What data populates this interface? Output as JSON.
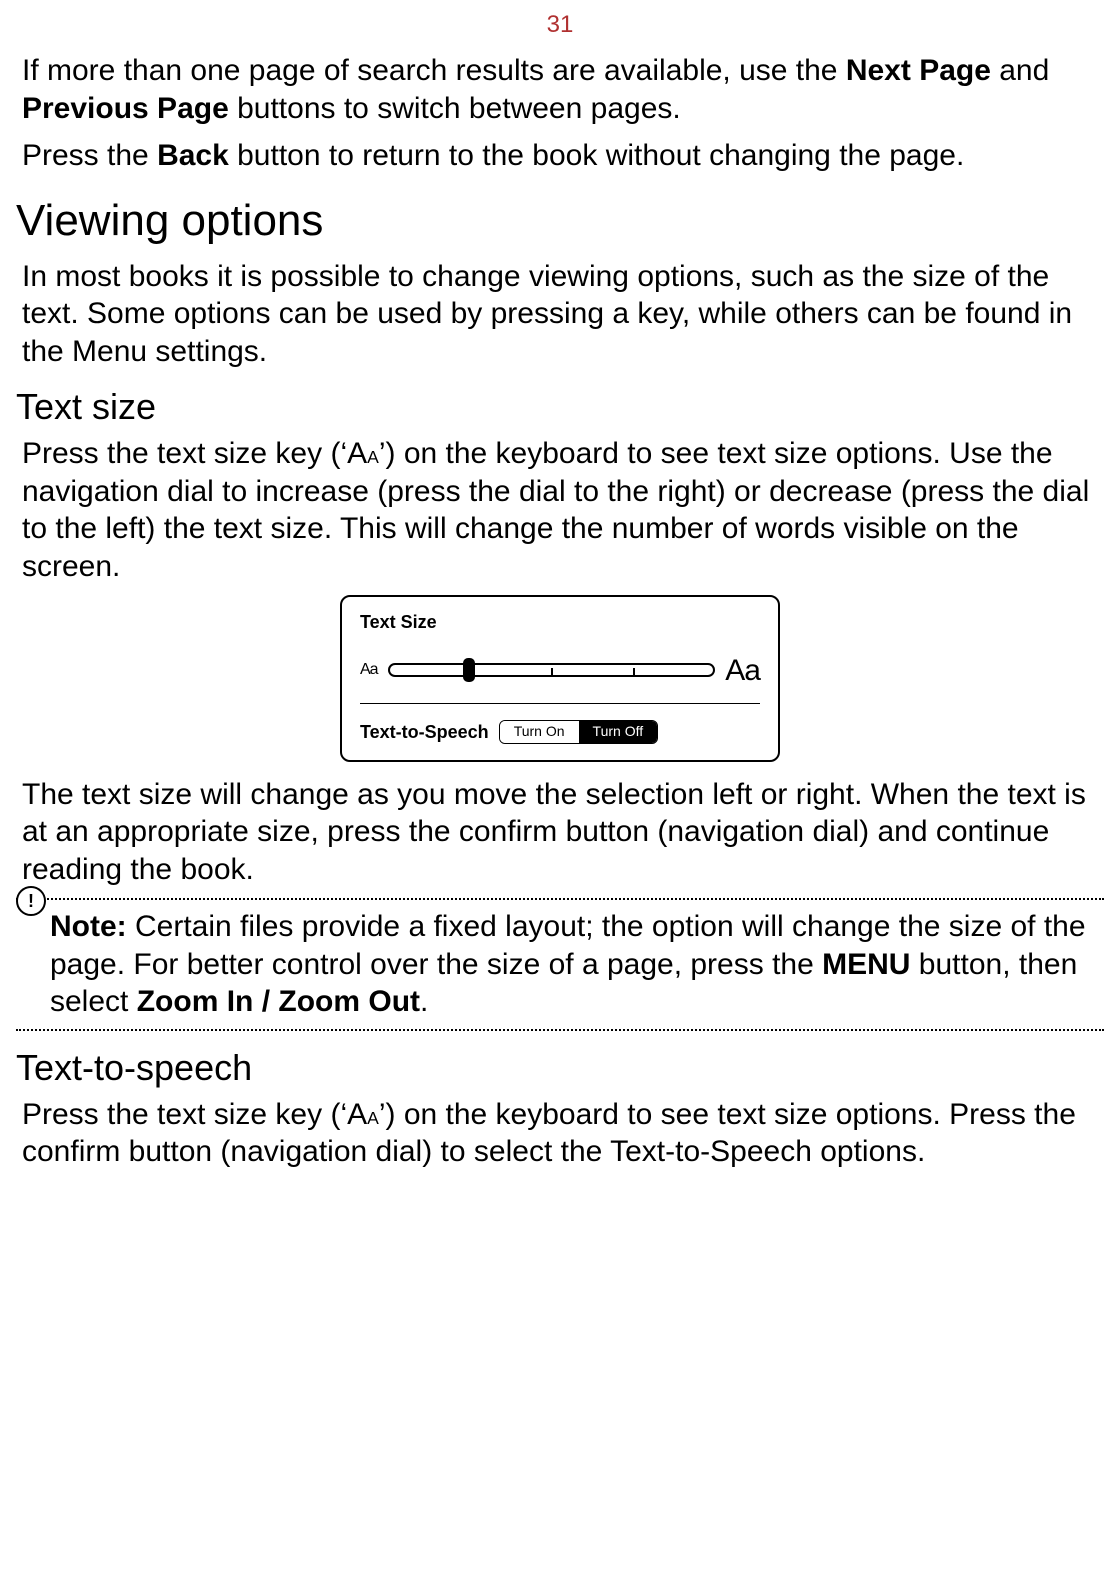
{
  "page": {
    "number": "31"
  },
  "intro": {
    "p1_a": "If more than one page of search results are available, use the ",
    "p1_b1": "Next Page",
    "p1_c": " and ",
    "p1_b2": "Previous Page",
    "p1_d": " buttons to switch between pages.",
    "p2_a": "Press the ",
    "p2_b": "Back",
    "p2_c": " button to return to the book without changing the page."
  },
  "sections": {
    "viewing_options": {
      "title": "Viewing options",
      "intro": "In most books it is possible to change viewing options, such as the size of the text. Some options can be used by pressing a key, while others can be found in the Menu settings."
    },
    "text_size": {
      "title": "Text size",
      "p1_a": "Press the text size key (‘A",
      "p1_small": "A",
      "p1_b": "’) on the keyboard to see text size options. Use the navigation dial to increase (press the dial to the right) or decrease (press the dial to the left) the text size. This will change the number of words visible on the screen.",
      "p2": "The text size will change as you move the selection left or right. When the text is at an appropriate size, press the confirm button (navigation dial) and continue reading the book."
    },
    "text_to_speech": {
      "title": "Text-to-speech",
      "p1_a": "Press the text size key (‘A",
      "p1_small": "A",
      "p1_b": "’) on the keyboard to see text size options. Press the confirm button (navigation dial) to select the Text-to-Speech options."
    }
  },
  "figure": {
    "title": "Text Size",
    "left_label": "Aa",
    "right_label": "Aa",
    "tts_label": "Text-to-Speech",
    "turn_on": "Turn On",
    "turn_off": "Turn Off"
  },
  "note": {
    "label": "Note:",
    "t1": " Certain files provide a fixed layout; the option will change the size of the page. For better control over the size of a page, press the ",
    "b1": "MENU",
    "t2": " button, then select ",
    "b2": "Zoom In",
    "t3": " / ",
    "b3": "Zoom Out",
    "t4": "."
  }
}
